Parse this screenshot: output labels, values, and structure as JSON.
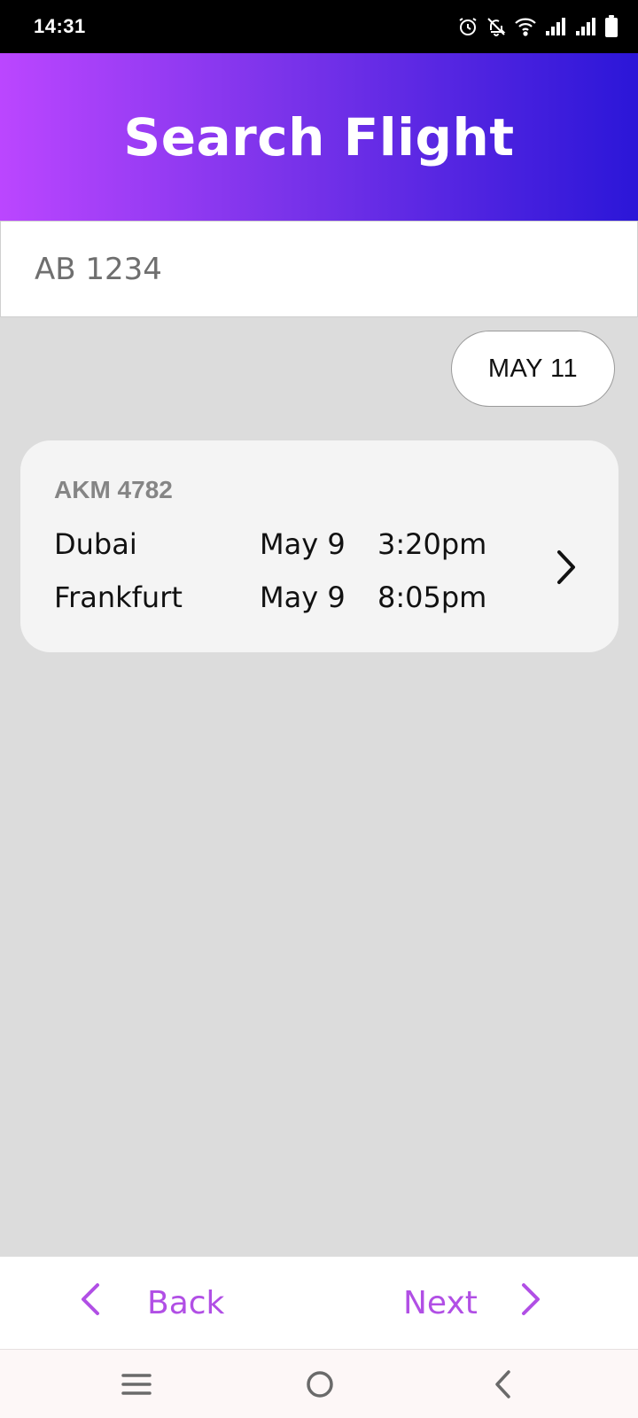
{
  "status_bar": {
    "time": "14:31",
    "icons": [
      "alarm-icon",
      "mute-icon",
      "wifi-icon",
      "signal-icon",
      "signal-icon",
      "battery-icon"
    ]
  },
  "header": {
    "title": "Search Flight"
  },
  "search": {
    "placeholder": "AB 1234"
  },
  "date_filter": {
    "label": "MAY 11"
  },
  "results": [
    {
      "flight_code": "AKM 4782",
      "departure": {
        "city": "Dubai",
        "date": "May 9",
        "time": "3:20pm"
      },
      "arrival": {
        "city": "Frankfurt",
        "date": "May 9",
        "time": "8:05pm"
      }
    }
  ],
  "nav": {
    "back_label": "Back",
    "next_label": "Next"
  },
  "colors": {
    "accent": "#b14fe5",
    "header_gradient_start": "#bb46ff",
    "header_gradient_end": "#2b16d8",
    "background": "#dcdcdc"
  }
}
